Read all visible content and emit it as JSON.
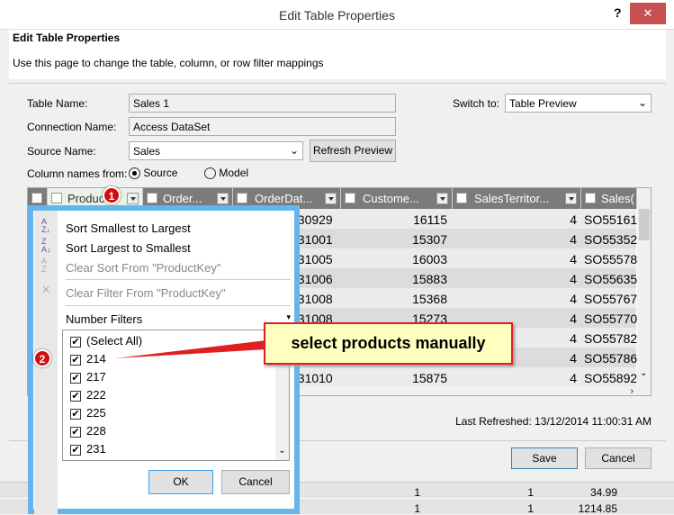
{
  "window": {
    "title": "Edit Table Properties",
    "help": "?",
    "close": "✕"
  },
  "header": {
    "title": "Edit Table Properties",
    "description": "Use this page to change the table, column, or row filter mappings"
  },
  "form": {
    "table_name_label": "Table Name:",
    "table_name": "Sales 1",
    "connection_label": "Connection Name:",
    "connection": "Access DataSet",
    "source_label": "Source Name:",
    "source": "Sales",
    "refresh": "Refresh Preview",
    "colnames_label": "Column names from:",
    "opt_source": "Source",
    "opt_model": "Model",
    "switch_label": "Switch to:",
    "switch_value": "Table Preview"
  },
  "grid": {
    "columns": [
      "Produc",
      "Order...",
      "OrderDat...",
      "Custome...",
      "SalesTerritor...",
      "Sales("
    ],
    "rows": [
      [
        "030929",
        "16115",
        "4",
        "SO55161"
      ],
      [
        "031001",
        "15307",
        "4",
        "SO55352"
      ],
      [
        "031005",
        "16003",
        "4",
        "SO55578"
      ],
      [
        "031006",
        "15883",
        "4",
        "SO55635"
      ],
      [
        "031008",
        "15368",
        "4",
        "SO55767"
      ],
      [
        "031008",
        "15273",
        "4",
        "SO55770"
      ],
      [
        "",
        "",
        "4",
        "SO55782"
      ],
      [
        "",
        "",
        "4",
        "SO55786"
      ],
      [
        "031010",
        "15875",
        "4",
        "SO55892"
      ]
    ]
  },
  "footer": {
    "last_refreshed": "Last Refreshed: 13/12/2014 11:00:31 AM",
    "save": "Save",
    "cancel": "Cancel"
  },
  "background_rows": [
    [
      "1",
      "1",
      "34.99"
    ],
    [
      "1",
      "1",
      "1214.85"
    ]
  ],
  "popup": {
    "sort_asc": "Sort Smallest to Largest",
    "sort_desc": "Sort Largest to Smallest",
    "clear_sort": "Clear Sort From \"ProductKey\"",
    "clear_filter": "Clear Filter From \"ProductKey\"",
    "number_filters": "Number Filters",
    "items": [
      "(Select All)",
      "214",
      "217",
      "222",
      "225",
      "228",
      "231"
    ],
    "ok": "OK",
    "cancel": "Cancel"
  },
  "annotations": {
    "badge1": "1",
    "badge2": "2",
    "callout": "select products manually"
  },
  "colors": {
    "accent": "#63b5ea",
    "callout_bg": "#ffffc0",
    "callout_border": "#e02020",
    "header_bg": "#7b7b7b"
  }
}
